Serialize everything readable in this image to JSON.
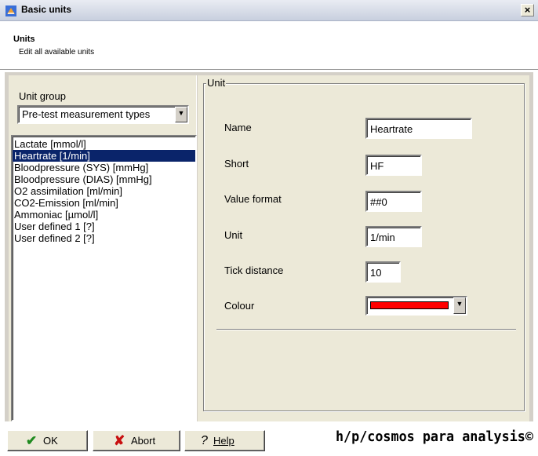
{
  "window": {
    "title": "Basic units",
    "close_glyph": "×"
  },
  "header": {
    "title": "Units",
    "subtitle": "Edit all available units"
  },
  "unit_group": {
    "label": "Unit group",
    "selected": "Pre-test measurement types",
    "items": [
      "Lactate [mmol/l]",
      "Heartrate [1/min]",
      "Bloodpressure (SYS) [mmHg]",
      "Bloodpressure (DIAS) [mmHg]",
      "O2 assimilation [ml/min]",
      "CO2-Emission [ml/min]",
      "Ammoniac [µmol/l]",
      "User defined 1 [?]",
      "User defined 2 [?]"
    ],
    "selected_index": 1
  },
  "unit": {
    "legend": "Unit",
    "name_label": "Name",
    "name_value": "Heartrate",
    "short_label": "Short",
    "short_value": "HF",
    "format_label": "Value format",
    "format_value": "##0",
    "unit_label": "Unit",
    "unit_value": "1/min",
    "tick_label": "Tick distance",
    "tick_value": "10",
    "colour_label": "Colour",
    "colour_value": "#ff0000"
  },
  "buttons": {
    "ok": "OK",
    "ok_icon": "check-icon",
    "abort": "Abort",
    "abort_icon": "x-icon",
    "help": "Help",
    "help_icon": "question-icon"
  },
  "brand": "h/p/cosmos para analysis©",
  "colors": {
    "selection": "#0a246a",
    "panel": "#ece9d8"
  }
}
